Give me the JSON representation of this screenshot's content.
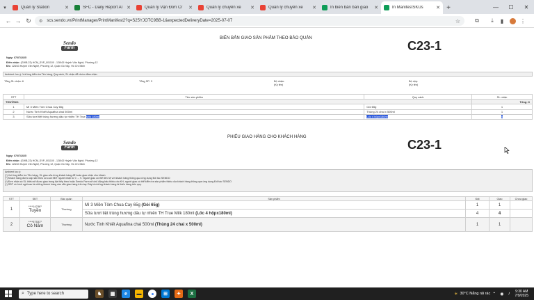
{
  "browser": {
    "tabs": [
      {
        "label": "Quản lý Station",
        "color": "#e94235"
      },
      {
        "label": "SFC - Daily Report Al",
        "color": "#188038"
      },
      {
        "label": "Quản lý Vận Đơn Cr",
        "color": "#e94235"
      },
      {
        "label": "Quản lý chuyển xe",
        "color": "#e94235"
      },
      {
        "label": "Quản lý chuyển xe",
        "color": "#e94235"
      },
      {
        "label": "In biên bản bàn giao",
        "color": "#0f9d58"
      },
      {
        "label": "In ManifestSKUs",
        "color": "#0f9d58",
        "active": true
      }
    ],
    "url": "scs.sendo.vn/PrintManager/PrintManifest2?q=S25YJOTC9BB-1&expectedDeliveryDate=2025-07-07"
  },
  "section1": {
    "logo_top": "Sendo",
    "logo_bottom": "Farm",
    "title": "BIÊN BẢN GIAO SẢN PHẨM THEO BẢO QUẢN",
    "code": "C23-1",
    "date": "Ngày: 07/07/2025",
    "pickup_label": "Điểm nhận:",
    "pickup_value": "(GWB-23) HCM_SVP_001100 - 128/43 Huỳnh Văn Nghệ, Phường 12",
    "address_label": "Đ/c:",
    "address_value": "128/43 Huỳnh Văn Nghệ, Phường 12, Quận Gò Vấp, Hồ Chí Minh",
    "note": "Ambient: lưu ý: Vui lòng kiểm tra Tên hàng, Quy cách, SL nhận để nhớm đảm nhận",
    "summary": {
      "total_sl": "Tổng SL nhận: 6",
      "total_sp": "Tổng SP: 3",
      "giver_label": "Bộ nhận:",
      "giver_sign": "(Ký tên)",
      "receiver_label": "Bộ nộp:",
      "receiver_sign": "(Ký tên)"
    },
    "table": {
      "headers": [
        "STT",
        "Tên sản phẩm",
        "Quy cách",
        "SL nhận"
      ],
      "group": "THƯỜNG:",
      "group_total": "Tổng: 6",
      "rows": [
        {
          "stt": "1",
          "name": "Mì 3 Miền Tôm Chua Cay 65g",
          "name_hl": "",
          "spec": "Gói 65g",
          "spec_hl": "",
          "qty": "1"
        },
        {
          "stt": "2",
          "name": "Nước Tinh Khiết Aquafina chai 500ml",
          "name_hl": "",
          "spec": "Thùng 24 chai x 500ml",
          "spec_hl": "",
          "qty": "1"
        },
        {
          "stt": "3",
          "name": "Sữa tươi tiệt trùng hương dâu tự nhiên TH True ",
          "name_hl": "Milk 180ml",
          "spec": "",
          "spec_hl": "Lốc 4 hộpx180ml",
          "qty": "4"
        }
      ]
    }
  },
  "section2": {
    "logo_top": "Sendo",
    "logo_bottom": "Farm",
    "title": "PHIẾU GIAO HÀNG CHO KHÁCH HÀNG",
    "code": "C23-1",
    "date": "Ngày: 07/07/2025",
    "pickup_label": "Điểm nhận:",
    "pickup_value": "(GWB-23) HCM_SVP_001100 - 128/43 Huỳnh Văn Nghệ, Phường 12",
    "address_label": "Đ/c:",
    "address_value": "128/43 Huỳnh Văn Nghệ, Phường 12, Quận Gò Vấp, Hồ Chí Minh",
    "notes": [
      "Ambient lưu ý:",
      "(*) Vui lòng kiểm tra Tên hàng, SL giao của từng khách hàng để hoàn giao nhận cho khách",
      "(*) Khách hàng được cấp sẵn theo số cuối SĐT người nhận từ 0 → 9. Người giao có thể tiến hệ với khách hàng thông qua ứng dụng Đối tác SENDO",
      "(*) Đơn nhận có SL thiếu sẽ được giao trong đợt tiếp theo hoặc Sendo Farm sẽ chủ động bảo thiếu cho KH, người giao có thể kiểm tra sản phẩm thiếu của khách hàng thông qua ứng dụng Đối tác SENDO",
      "(*) SĐT có hình ngôi sao là những khách hàng cần cẩn giao hàng trên tay. Đây là những khách hàng là thiếu hàng trên quy."
    ],
    "table": {
      "headers": [
        "STT",
        "SĐT",
        "Bảo quản",
        "Sản phẩm",
        "Đặt",
        "Giao",
        "Chưa giao"
      ],
      "customers": [
        {
          "stt": "1",
          "phone": "****14236⁹",
          "name": "Tuyền",
          "storage": "Thường",
          "items": [
            {
              "product": "Mì 3 Miền Tôm Chua Cay 65g ",
              "spec": "(Gói 65g)",
              "ordered": "1",
              "delivered": "1"
            },
            {
              "product": "Sữa tươi tiệt trùng hương dâu tự nhiên TH True Milk 180ml ",
              "spec": "(Lốc 4 hộpx180ml)",
              "ordered": "4",
              "delivered": "4"
            }
          ]
        },
        {
          "stt": "2",
          "phone": "****57531⁹",
          "name": "Cô Năm",
          "storage": "Thường",
          "items": [
            {
              "product": "Nước Tinh Khiết Aquafina chai 500ml ",
              "spec": "(Thùng 24 chai x 500ml)",
              "ordered": "1",
              "delivered": "1"
            }
          ]
        }
      ]
    }
  },
  "taskbar": {
    "search_placeholder": "Type here to search",
    "weather": "30°C  Nắng rải rác",
    "time": "9:30 AM",
    "date": "7/9/2025"
  }
}
